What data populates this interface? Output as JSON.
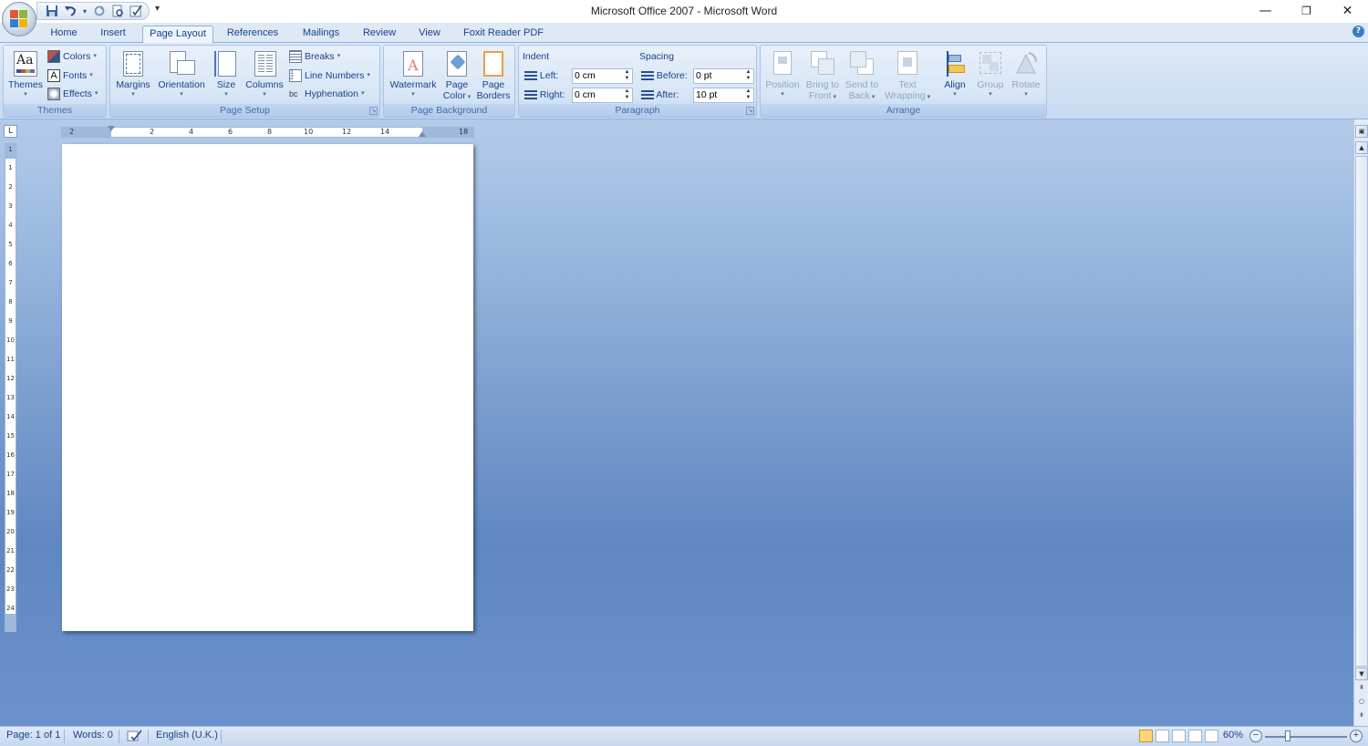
{
  "window": {
    "title": "Microsoft Office 2007 - Microsoft Word",
    "minimize_icon": "—",
    "restore_icon": "❐",
    "close_icon": "✕"
  },
  "qat": {
    "more_icon": "▾"
  },
  "tabs": [
    {
      "label": "Home"
    },
    {
      "label": "Insert"
    },
    {
      "label": "Page Layout",
      "active": true
    },
    {
      "label": "References"
    },
    {
      "label": "Mailings"
    },
    {
      "label": "Review"
    },
    {
      "label": "View"
    },
    {
      "label": "Foxit Reader PDF"
    }
  ],
  "ribbon": {
    "themes": {
      "group_label": "Themes",
      "themes_btn": "Themes",
      "colors_btn": "Colors",
      "fonts_btn": "Fonts",
      "effects_btn": "Effects",
      "themes_icon_text": "Aa"
    },
    "page_setup": {
      "group_label": "Page Setup",
      "margins": "Margins",
      "orientation": "Orientation",
      "size": "Size",
      "columns": "Columns",
      "breaks": "Breaks",
      "line_numbers": "Line Numbers",
      "hyphenation": "Hyphenation"
    },
    "page_background": {
      "group_label": "Page Background",
      "watermark": "Watermark",
      "page_color_line1": "Page",
      "page_color_line2": "Color",
      "page_borders_line1": "Page",
      "page_borders_line2": "Borders"
    },
    "paragraph": {
      "group_label": "Paragraph",
      "indent_title": "Indent",
      "spacing_title": "Spacing",
      "left_label": "Left:",
      "left_value": "0 cm",
      "right_label": "Right:",
      "right_value": "0 cm",
      "before_label": "Before:",
      "before_value": "0 pt",
      "after_label": "After:",
      "after_value": "10 pt"
    },
    "arrange": {
      "group_label": "Arrange",
      "position": "Position",
      "bring_front_line1": "Bring to",
      "bring_front_line2": "Front",
      "send_back_line1": "Send to",
      "send_back_line2": "Back",
      "text_wrap_line1": "Text",
      "text_wrap_line2": "Wrapping",
      "align": "Align",
      "group": "Group",
      "rotate": "Rotate"
    }
  },
  "ruler": {
    "corner": "L",
    "h_ticks": [
      "2",
      "2",
      "4",
      "6",
      "8",
      "10",
      "12",
      "14",
      "18"
    ],
    "v_ticks": [
      "1",
      "1",
      "2",
      "3",
      "4",
      "5",
      "6",
      "7",
      "8",
      "9",
      "10",
      "11",
      "12",
      "13",
      "14",
      "15",
      "16",
      "17",
      "18",
      "19",
      "20",
      "21",
      "22",
      "23",
      "24"
    ]
  },
  "status": {
    "page": "Page: 1 of 1",
    "words": "Words: 0",
    "language": "English (U.K.)",
    "zoom": "60%",
    "zoom_level_percent": 60
  },
  "colors": {
    "ribbon_text": "#15428b",
    "doc_background": "#6b92cc",
    "accent": "#8db2e3"
  }
}
